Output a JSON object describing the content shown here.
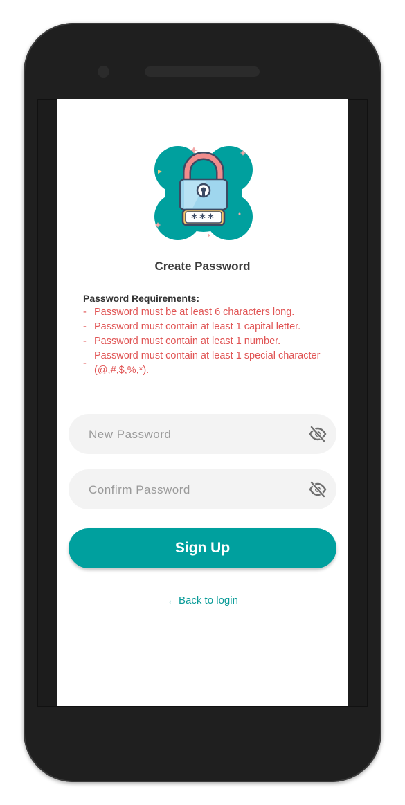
{
  "screen": {
    "title": "Create Password",
    "requirements_heading": "Password Requirements:",
    "requirements": [
      "Password must be at least 6 characters long.",
      "Password must contain at least 1 capital letter.",
      "Password must contain at least 1 number.",
      "Password must contain at least 1 special character (@,#,$,%,*)."
    ],
    "requirement_bullet": "-",
    "new_password": {
      "placeholder": "New Password",
      "value": ""
    },
    "confirm_password": {
      "placeholder": "Confirm Password",
      "value": ""
    },
    "signup_label": "Sign Up",
    "back_arrow": "←",
    "back_label": "Back to login",
    "illustration_text": "***"
  },
  "icons": {
    "illustration": "padlock-illustration",
    "visibility": "eye-off-icon",
    "back": "arrow-left-icon"
  },
  "colors": {
    "accent": "#00a09e",
    "error": "#e05454",
    "field_background": "#f3f3f3",
    "phone_body": "#1f1f1f"
  }
}
